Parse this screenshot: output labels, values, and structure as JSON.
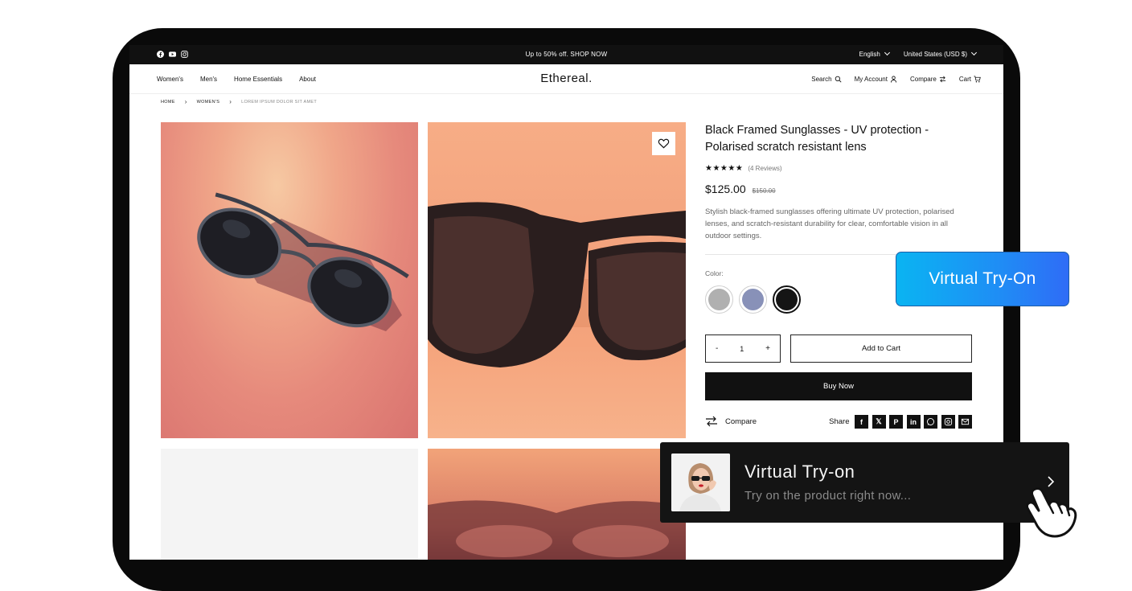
{
  "announcement": {
    "promo": "Up to 50% off. SHOP NOW",
    "language": "English",
    "currency": "United States (USD $)",
    "socials": [
      "facebook-icon",
      "youtube-icon",
      "instagram-icon"
    ]
  },
  "header": {
    "logo": "Ethereal.",
    "nav": [
      "Women's",
      "Men's",
      "Home Essentials",
      "About"
    ],
    "search": "Search",
    "account": "My Account",
    "compare": "Compare",
    "cart": "Cart"
  },
  "breadcrumb": [
    "HOME",
    "WOMEN'S",
    "LOREM IPSUM DOLOR SIT AMET"
  ],
  "product": {
    "title": "Black Framed Sunglasses - UV protection - Polarised scratch resistant lens",
    "stars": "★★★★★",
    "rating_value": 5,
    "reviews": "(4 Reviews)",
    "price": "$125.00",
    "old_price": "$150.00",
    "description": "Stylish black-framed sunglasses offering ultimate UV protection, polarised lenses, and scratch-resistant durability for clear, comfortable vision in all outdoor settings.",
    "color_label": "Color:",
    "colors": [
      {
        "name": "silver",
        "hex": "#b0b0b0",
        "selected": false
      },
      {
        "name": "blue-grey",
        "hex": "#8891b8",
        "selected": false
      },
      {
        "name": "black",
        "hex": "#151515",
        "selected": true
      }
    ],
    "qty_minus": "-",
    "qty_value": "1",
    "qty_plus": "+",
    "add_to_cart": "Add to Cart",
    "buy_now": "Buy Now",
    "compare": "Compare",
    "share_label": "Share",
    "share_icons": [
      "facebook-icon",
      "x-icon",
      "pinterest-icon",
      "linkedin-icon",
      "whatsapp-icon",
      "instagram-icon",
      "email-icon"
    ]
  },
  "overlay": {
    "vto_button": "Virtual Try-On",
    "card_title": "Virtual Try-on",
    "card_subtitle": "Try on the product right now..."
  },
  "colors": {
    "vto_gradient_start": "#0ab4f2",
    "vto_gradient_end": "#2f6cf6",
    "dark": "#111111"
  }
}
